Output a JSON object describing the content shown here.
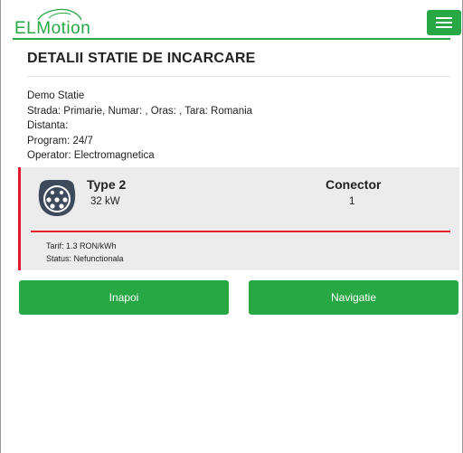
{
  "header": {
    "logo_text": "ELMotion",
    "brand_color": "#28a745",
    "menu_icon": "hamburger-icon"
  },
  "page": {
    "title": "DETALII STATIE DE INCARCARE"
  },
  "station": {
    "name": "Demo Statie",
    "address": "Strada: Primarie, Numar: , Oras: , Tara: Romania",
    "distance": "Distanta:",
    "schedule": "Program: 24/7",
    "operator": "Operator: Electromagnetica"
  },
  "connector": {
    "icon": "type2-plug-icon",
    "type": "Type 2",
    "power": "32 kW",
    "connector_label": "Conector",
    "connector_number": "1",
    "tariff": "Tarif: 1.3 RON/kWh",
    "status": "Status: Nefunctionala",
    "status_color": "#e5172c"
  },
  "actions": {
    "back_label": "Inapoi",
    "navigate_label": "Navigatie"
  }
}
